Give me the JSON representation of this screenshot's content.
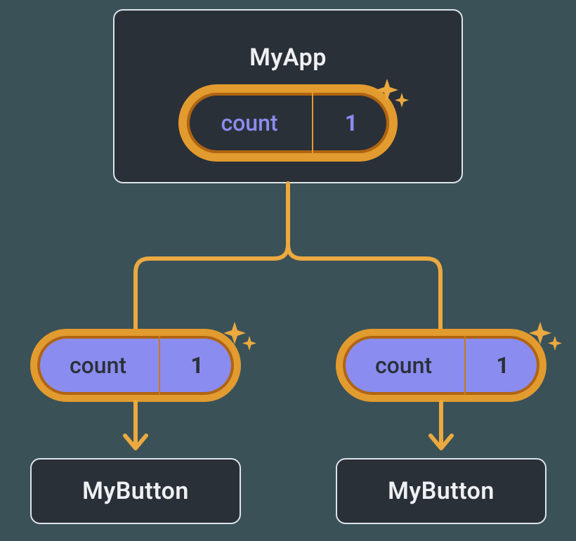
{
  "parent": {
    "title": "MyApp",
    "state_name": "count",
    "state_value": "1"
  },
  "children": [
    {
      "prop_name": "count",
      "prop_value": "1",
      "title": "MyButton"
    },
    {
      "prop_name": "count",
      "prop_value": "1",
      "title": "MyButton"
    }
  ],
  "colors": {
    "node_bg": "#2a3038",
    "node_border": "#dde3eb",
    "accent": "#e29b2e",
    "accent_dark": "#b1640f",
    "prop_bg": "#8b8cf0",
    "text_light": "#eef0f3"
  }
}
